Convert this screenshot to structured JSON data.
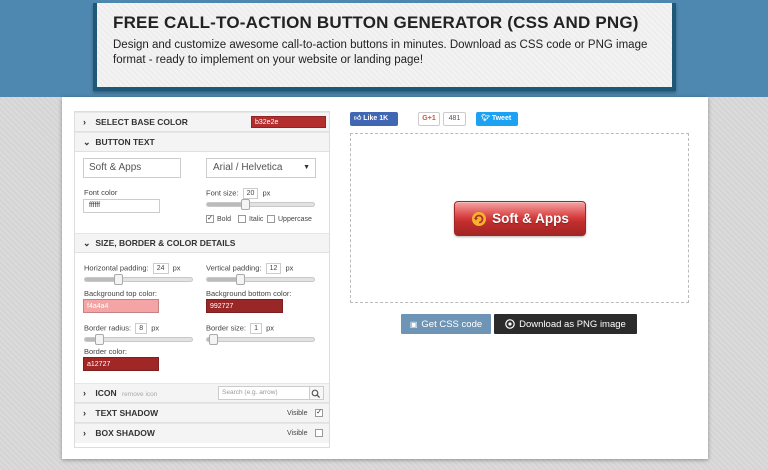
{
  "header": {
    "title": "FREE CALL-TO-ACTION BUTTON GENERATOR (CSS AND PNG)",
    "description": "Design and customize awesome call-to-action buttons in minutes. Download as CSS code or PNG image format - ready to implement on your website or landing page!"
  },
  "base_color": {
    "label": "SELECT BASE COLOR",
    "value": "b32e2e",
    "swatch": "#b32e2e"
  },
  "button_text": {
    "label": "BUTTON TEXT",
    "text_value": "Soft & Apps",
    "font_select": "Arial / Helvetica",
    "font_color_label": "Font color",
    "font_color_value": "ffffff",
    "font_size_label": "Font size:",
    "font_size_value": "20",
    "unit": "px",
    "bold_label": "Bold",
    "bold_checked": "✓",
    "italic_label": "Italic",
    "uppercase_label": "Uppercase",
    "font_size_level": 0.35
  },
  "details": {
    "label": "SIZE, BORDER & COLOR DETAILS",
    "h_padding_label": "Horizontal padding:",
    "h_padding_value": "24",
    "v_padding_label": "Vertical padding:",
    "v_padding_value": "12",
    "unit": "px",
    "bg_top_label": "Background top color:",
    "bg_top_value": "f4a4a4",
    "bg_top_color": "#f4a4a4",
    "bg_bottom_label": "Background bottom color:",
    "bg_bottom_value": "992727",
    "bg_bottom_color": "#992727",
    "border_radius_label": "Border radius:",
    "border_radius_value": "8",
    "border_size_label": "Border size:",
    "border_size_value": "1",
    "border_color_label": "Border color:",
    "border_color_value": "a12727",
    "border_color": "#a12727",
    "h_padding_level": 0.3,
    "v_padding_level": 0.3,
    "border_radius_level": 0.1,
    "border_size_level": 0.02
  },
  "icon": {
    "label": "ICON",
    "remove_label": "remove icon",
    "search_placeholder": "Search (e.g. arrow)"
  },
  "text_shadow": {
    "label": "TEXT SHADOW",
    "visible_label": "Visible",
    "checked": "✓"
  },
  "box_shadow": {
    "label": "BOX SHADOW",
    "visible_label": "Visible",
    "checked": ""
  },
  "social": {
    "like_label": "Like",
    "like_count": "1K",
    "gplus_label": "G+1",
    "gplus_count": "481",
    "tweet_label": "Tweet"
  },
  "preview": {
    "button_text": "Soft & Apps",
    "button_icon": "rotate-arrow-icon"
  },
  "actions": {
    "get_css": "Get CSS code",
    "download_png": "Download as PNG image"
  }
}
